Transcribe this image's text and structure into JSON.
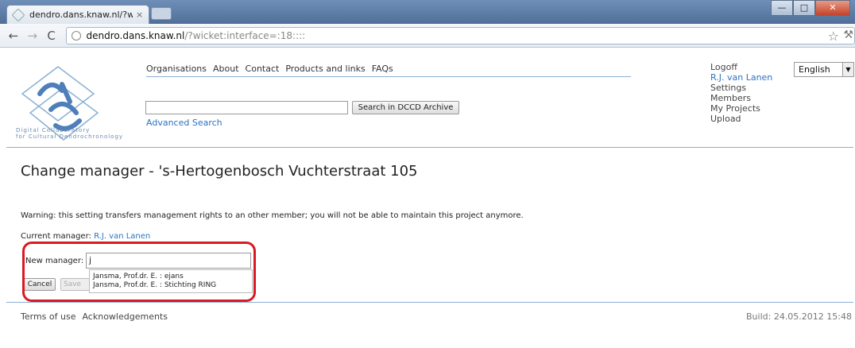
{
  "browser": {
    "tab_title": "dendro.dans.knaw.nl/?wick",
    "tab_close": "×",
    "url_host": "dendro.dans.knaw.nl",
    "url_rest": "/?wicket:interface=:18::::",
    "win_minimize": "—",
    "win_maximize": "□",
    "win_close": "✕",
    "back": "←",
    "forward": "→",
    "reload": "C",
    "star": "☆",
    "wrench": "⚒"
  },
  "header": {
    "logo_text_line1": "Digital        Collaboratory",
    "logo_text_line2": "for Cultural Dendrochronology",
    "nav": [
      "Organisations",
      "About",
      "Contact",
      "Products and links",
      "FAQs"
    ],
    "search_button": "Search in DCCD Archive",
    "search_value": "",
    "advanced_search": "Advanced Search",
    "user_links": {
      "logoff": "Logoff",
      "username": "R.J. van Lanen",
      "settings": "Settings",
      "members": "Members",
      "my_projects": "My Projects",
      "upload": "Upload"
    },
    "language": "English",
    "language_arrow": "▼"
  },
  "main": {
    "title": "Change manager - 's-Hertogenbosch Vuchterstraat 105",
    "warning": "Warning: this setting transfers management rights to an other member; you will not be able to maintain this project anymore.",
    "current_manager_label": "Current manager:",
    "current_manager_value": "R.J. van Lanen",
    "new_manager_label": "New manager:",
    "new_manager_value": "j",
    "cancel_label": "Cancel",
    "save_label": "Save",
    "suggestions": [
      "Jansma, Prof.dr. E. : ejans",
      "Jansma, Prof.dr. E. : Stichting RING"
    ]
  },
  "footer": {
    "links": [
      "Terms of use",
      "Acknowledgements"
    ],
    "build": "Build: 24.05.2012 15:48"
  },
  "colors": {
    "link": "#2a73c4",
    "rule": "#8bb0d4",
    "highlight": "#d91a24"
  }
}
